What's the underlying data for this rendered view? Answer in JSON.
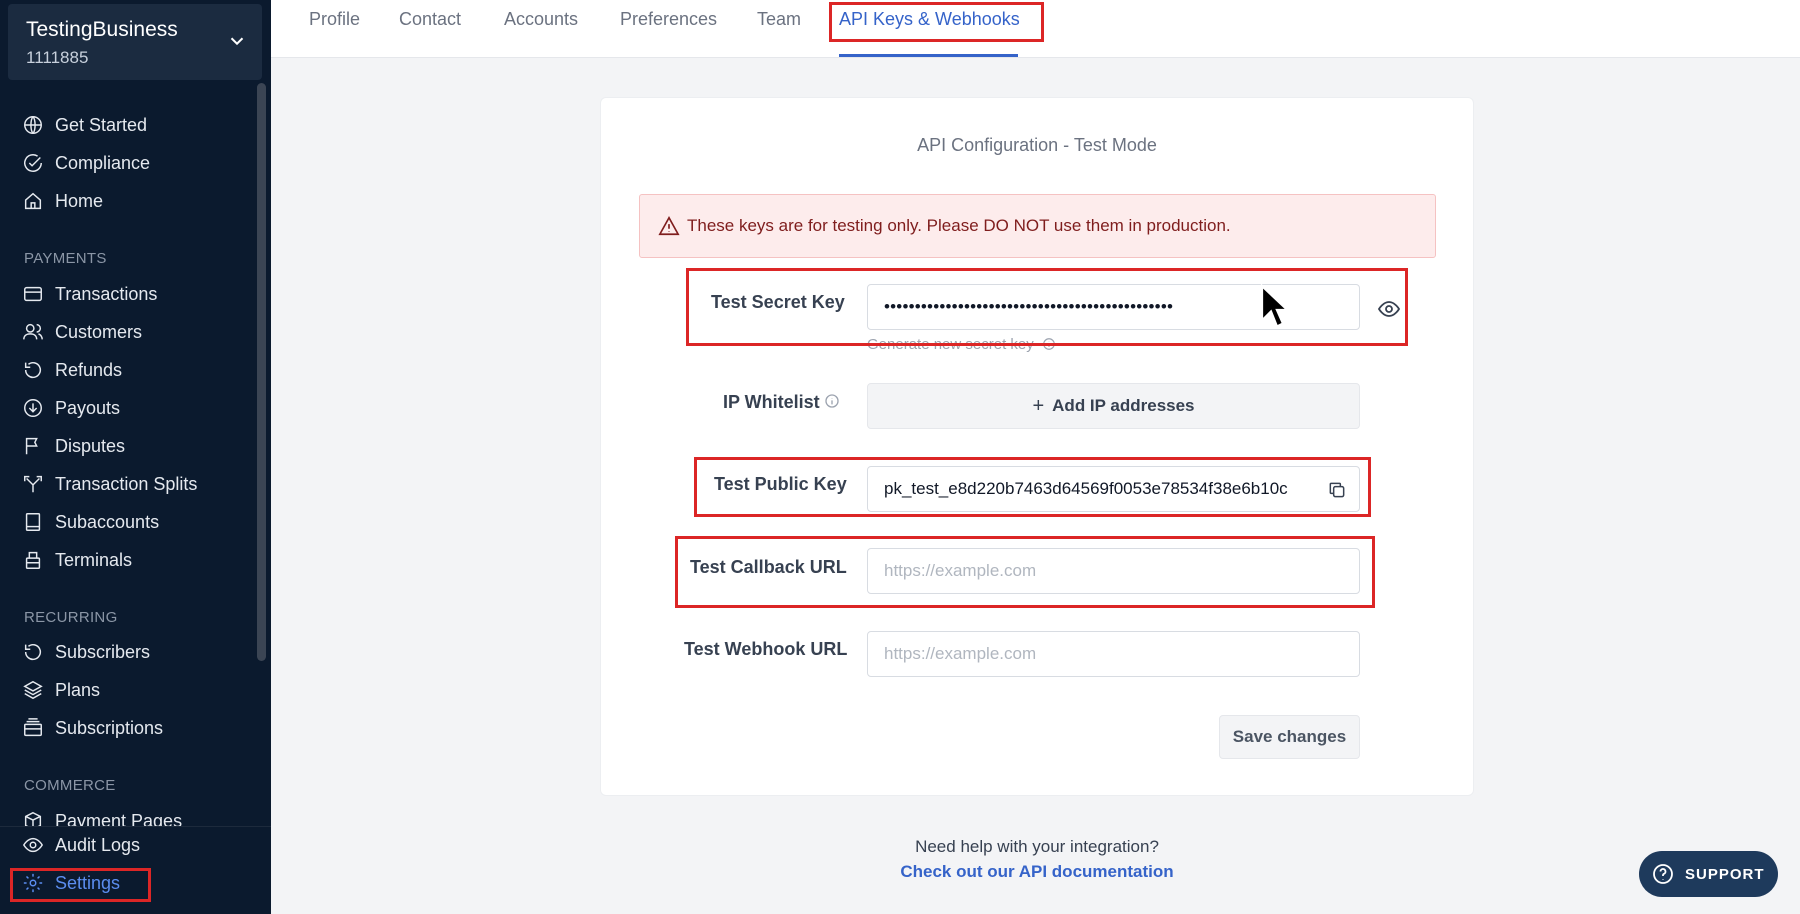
{
  "sidebar": {
    "business_name": "TestingBusiness",
    "business_id": "1111885",
    "items_top": [
      {
        "label": "Get Started",
        "icon": "globe-icon"
      },
      {
        "label": "Compliance",
        "icon": "check-circle-icon"
      },
      {
        "label": "Home",
        "icon": "home-icon"
      }
    ],
    "section_payments": "PAYMENTS",
    "items_payments": [
      {
        "label": "Transactions",
        "icon": "card-icon"
      },
      {
        "label": "Customers",
        "icon": "users-icon"
      },
      {
        "label": "Refunds",
        "icon": "refund-icon"
      },
      {
        "label": "Payouts",
        "icon": "payout-icon"
      },
      {
        "label": "Disputes",
        "icon": "flag-icon"
      },
      {
        "label": "Transaction Splits",
        "icon": "split-icon"
      },
      {
        "label": "Subaccounts",
        "icon": "book-icon"
      },
      {
        "label": "Terminals",
        "icon": "terminal-icon"
      }
    ],
    "section_recurring": "RECURRING",
    "items_recurring": [
      {
        "label": "Subscribers",
        "icon": "refresh-icon"
      },
      {
        "label": "Plans",
        "icon": "layers-icon"
      },
      {
        "label": "Subscriptions",
        "icon": "subscriptions-icon"
      }
    ],
    "section_commerce": "COMMERCE",
    "items_commerce": [
      {
        "label": "Payment Pages",
        "icon": "box-icon"
      }
    ],
    "audit_logs": "Audit Logs",
    "settings": "Settings"
  },
  "tabs": [
    "Profile",
    "Contact",
    "Accounts",
    "Preferences",
    "Team",
    "API Keys & Webhooks"
  ],
  "active_tab": "API Keys & Webhooks",
  "card": {
    "title": "API Configuration - Test Mode",
    "alert": "These keys are for testing only. Please DO NOT use them in production.",
    "secret_key_label": "Test Secret Key",
    "secret_key_value": "•••••••••••••••••••••••••••••••••••••••••••••••",
    "generate_link": "Generate new secret key",
    "ip_label": "IP Whitelist",
    "add_ip": "Add IP addresses",
    "public_key_label": "Test Public Key",
    "public_key_value": "pk_test_e8d220b7463d64569f0053e78534f38e6b10c",
    "callback_label": "Test Callback URL",
    "callback_placeholder": "https://example.com",
    "webhook_label": "Test Webhook URL",
    "webhook_placeholder": "https://example.com",
    "save": "Save changes"
  },
  "help": {
    "question": "Need help with your integration?",
    "link": "Check out our API documentation"
  },
  "support": "SUPPORT",
  "colors": {
    "sidebar_bg": "#0b1a2e",
    "accent": "#3563c9",
    "highlight": "#dc2626",
    "alert_bg": "#fdecec"
  }
}
